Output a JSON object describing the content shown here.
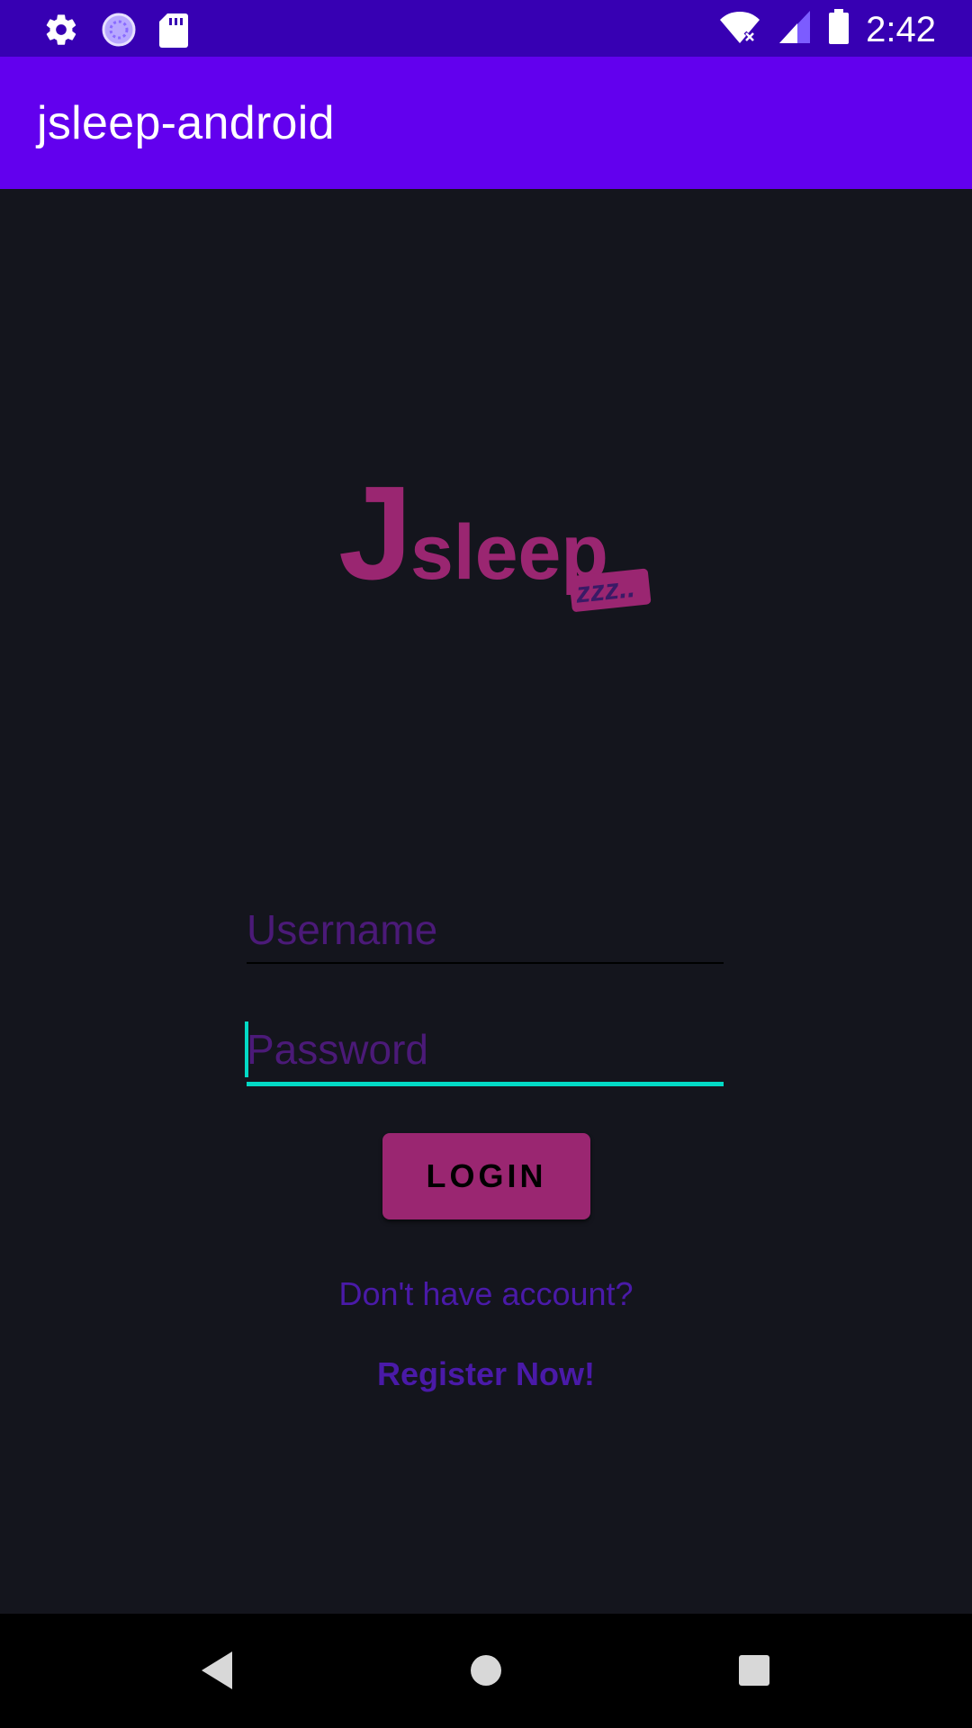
{
  "status_bar": {
    "time": "2:42",
    "left_icons": [
      "settings-icon",
      "sync-icon",
      "sd-card-icon"
    ],
    "right_icons": [
      "wifi-off-icon",
      "signal-icon",
      "battery-icon"
    ]
  },
  "app_bar": {
    "title": "jsleep-android"
  },
  "logo": {
    "text_j": "J",
    "text_sleep": "sleep",
    "badge": "zzz..",
    "color": "#9a2671"
  },
  "form": {
    "username_placeholder": "Username",
    "password_placeholder": "Password",
    "login_label": "LOGIN",
    "no_account_text": "Don't have account?",
    "register_label": "Register Now!"
  },
  "colors": {
    "status_bar": "#3700b3",
    "app_bar": "#6200ee",
    "background": "#14151d",
    "accent": "#03dac5",
    "button": "#9a2671",
    "link": "#4a1aa8"
  },
  "nav_bar": {
    "icons": [
      "back-icon",
      "home-icon",
      "recents-icon"
    ]
  }
}
